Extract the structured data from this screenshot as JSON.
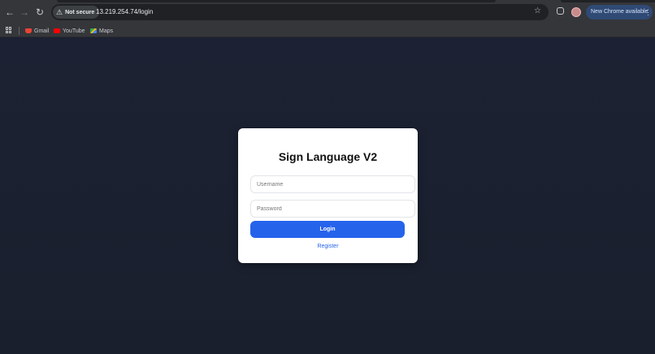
{
  "browser": {
    "security_label": "Not secure",
    "url": "13.219.254.74/login",
    "new_chrome_label": "New Chrome available",
    "bookmarks": [
      {
        "label": "Gmail",
        "icon": "gmail-icon"
      },
      {
        "label": "YouTube",
        "icon": "youtube-icon"
      },
      {
        "label": "Maps",
        "icon": "maps-icon"
      }
    ]
  },
  "login": {
    "title": "Sign Language V2",
    "username_placeholder": "Username",
    "password_placeholder": "Password",
    "login_label": "Login",
    "register_label": "Register"
  },
  "colors": {
    "page_background": "#1b2131",
    "primary": "#2563eb",
    "card": "#ffffff"
  }
}
